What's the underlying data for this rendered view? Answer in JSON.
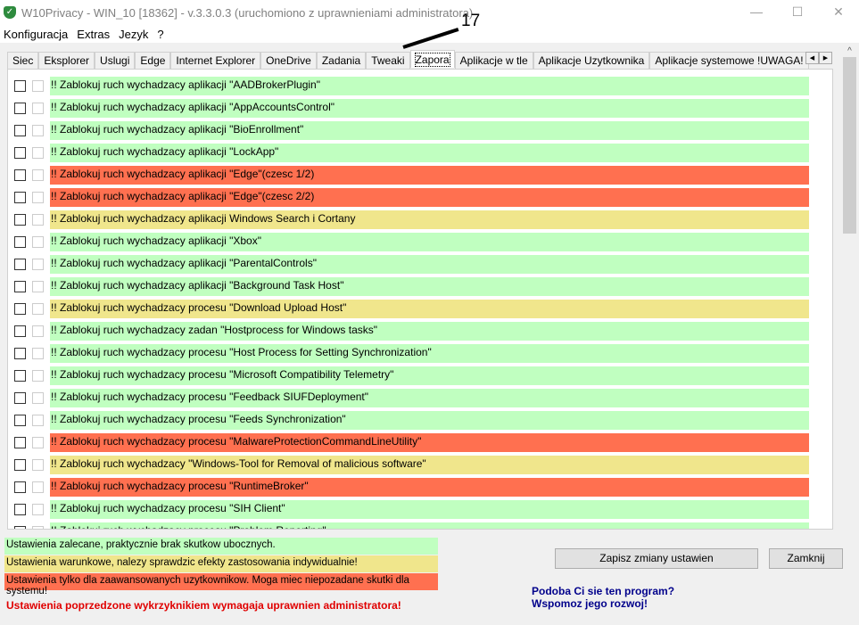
{
  "window": {
    "title": "W10Privacy - WIN_10 [18362]  - v.3.3.0.3 (uruchomiono z uprawnieniami administratora)"
  },
  "menu": [
    "Konfiguracja",
    "Extras",
    "Jezyk",
    "?"
  ],
  "annotation": "17",
  "tabs": [
    "Siec",
    "Eksplorer",
    "Uslugi",
    "Edge",
    "Internet Explorer",
    "OneDrive",
    "Zadania",
    "Tweaki",
    "Zapora",
    "Aplikacje w tle",
    "Aplikacje Uzytkownika",
    "Aplikacje systemowe !UWAGA!"
  ],
  "active_tab": "Zapora",
  "colors": {
    "green": "#c0ffc0",
    "yellow": "#f0e68c",
    "red": "#ff7050"
  },
  "rows": [
    {
      "label": "!! Zablokuj ruch wychadzacy aplikacji \"AADBrokerPlugin\"",
      "level": "green"
    },
    {
      "label": "!! Zablokuj ruch wychadzacy aplikacji \"AppAccountsControl\"",
      "level": "green"
    },
    {
      "label": "!! Zablokuj ruch wychadzacy aplikacji \"BioEnrollment\"",
      "level": "green"
    },
    {
      "label": "!! Zablokuj ruch wychadzacy aplikacji \"LockApp\"",
      "level": "green"
    },
    {
      "label": "!! Zablokuj ruch wychadzacy aplikacji \"Edge\"(czesc 1/2)",
      "level": "red"
    },
    {
      "label": "!! Zablokuj ruch wychadzacy aplikacji \"Edge\"(czesc 2/2)",
      "level": "red"
    },
    {
      "label": "!! Zablokuj ruch wychadzacy aplikacji Windows Search i Cortany",
      "level": "yellow"
    },
    {
      "label": "!! Zablokuj ruch wychadzacy aplikacji \"Xbox\"",
      "level": "green"
    },
    {
      "label": "!! Zablokuj ruch wychadzacy aplikacji \"ParentalControls\"",
      "level": "green"
    },
    {
      "label": "!! Zablokuj ruch wychadzacy aplikacji \"Background Task Host\"",
      "level": "green"
    },
    {
      "label": "!! Zablokuj ruch wychadzacy procesu \"Download Upload Host\"",
      "level": "yellow"
    },
    {
      "label": "!! Zablokuj ruch wychadzacy zadan \"Hostprocess for Windows tasks\"",
      "level": "green"
    },
    {
      "label": "!! Zablokuj ruch wychadzacy procesu \"Host Process for Setting Synchronization\"",
      "level": "green"
    },
    {
      "label": "!! Zablokuj ruch wychadzacy procesu \"Microsoft Compatibility Telemetry\"",
      "level": "green"
    },
    {
      "label": "!! Zablokuj ruch wychadzacy procesu \"Feedback SIUFDeployment\"",
      "level": "green"
    },
    {
      "label": "!! Zablokuj ruch wychadzacy procesu \"Feeds Synchronization\"",
      "level": "green"
    },
    {
      "label": "!! Zablokuj ruch wychadzacy procesu \"MalwareProtectionCommandLineUtility\"",
      "level": "red"
    },
    {
      "label": "!! Zablokuj ruch wychadzacy \"Windows-Tool for Removal of malicious software\"",
      "level": "yellow"
    },
    {
      "label": "!! Zablokuj ruch wychadzacy procesu \"RuntimeBroker\"",
      "level": "red"
    },
    {
      "label": "!! Zablokuj ruch wychadzacy procesu \"SIH Client\"",
      "level": "green"
    },
    {
      "label": "!! Zablokuj ruch wychadzacy procesu \"Problem Reporting\"",
      "level": "green"
    }
  ],
  "legend": {
    "green": "Ustawienia zalecane, praktycznie brak skutkow ubocznych.",
    "yellow": "Ustawienia warunkowe, nalezy sprawdzic efekty zastosowania indywidualnie!",
    "red": "Ustawienia tylko dla zaawansowanych uzytkownikow. Moga miec niepozadane skutki dla systemu!",
    "admin_note": "Ustawienia poprzedzone wykrzyknikiem wymagaja uprawnien administratora!"
  },
  "buttons": {
    "save": "Zapisz zmiany ustawien",
    "close": "Zamknij"
  },
  "donate": {
    "line1": "Podoba Ci sie ten program?",
    "line2": "Wspomoz jego rozwoj!"
  }
}
